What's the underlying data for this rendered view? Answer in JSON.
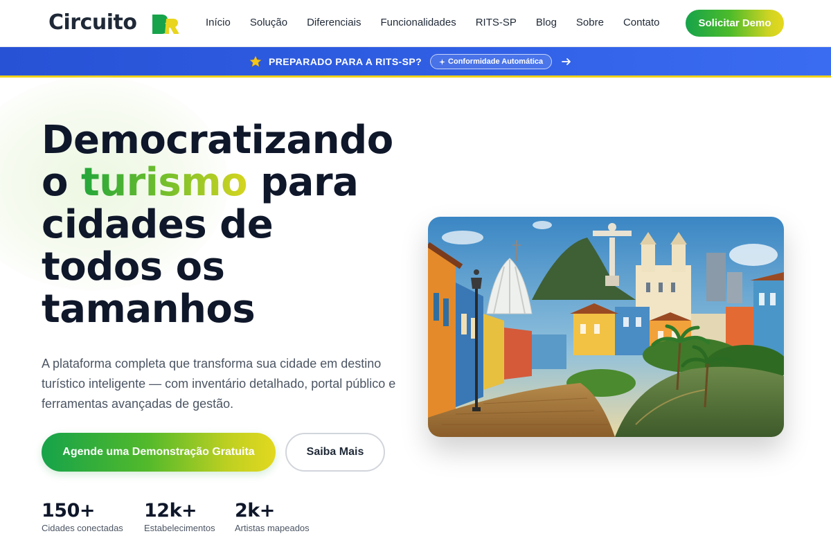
{
  "header": {
    "logo_text": "Circuito",
    "logo_badge": "BR",
    "nav": [
      "Início",
      "Solução",
      "Diferenciais",
      "Funcionalidades",
      "RITS-SP",
      "Blog",
      "Sobre",
      "Contato"
    ],
    "cta_label": "Solicitar Demo"
  },
  "banner": {
    "star_icon": "star-icon",
    "text": "PREPARADO PARA A RITS-SP?",
    "pill_label": "Conformidade Automática",
    "pill_icon": "sparkle-icon",
    "arrow_icon": "arrow-right-icon"
  },
  "hero": {
    "title_line1": "Democratizando",
    "title_o": "o ",
    "title_accent": "turismo",
    "title_para": " para",
    "title_line3": "cidades de",
    "title_line4": "todos os",
    "title_line5": "tamanhos",
    "description": "A plataforma completa que transforma sua cidade em destino turístico inteligente — com inventário detalhado, portal público e ferramentas avançadas de gestão.",
    "primary_button": "Agende uma Demonstração Gratuita",
    "secondary_button": "Saiba Mais"
  },
  "stats": [
    {
      "number": "150+",
      "label": "Cidades conectadas"
    },
    {
      "number": "12k+",
      "label": "Estabelecimentos"
    },
    {
      "number": "2k+",
      "label": "Artistas mapeados"
    }
  ],
  "colors": {
    "brand_green": "#16a34a",
    "brand_yellow": "#e3d81f",
    "banner_blue": "#2f5ee3",
    "text_dark": "#0f172a"
  }
}
